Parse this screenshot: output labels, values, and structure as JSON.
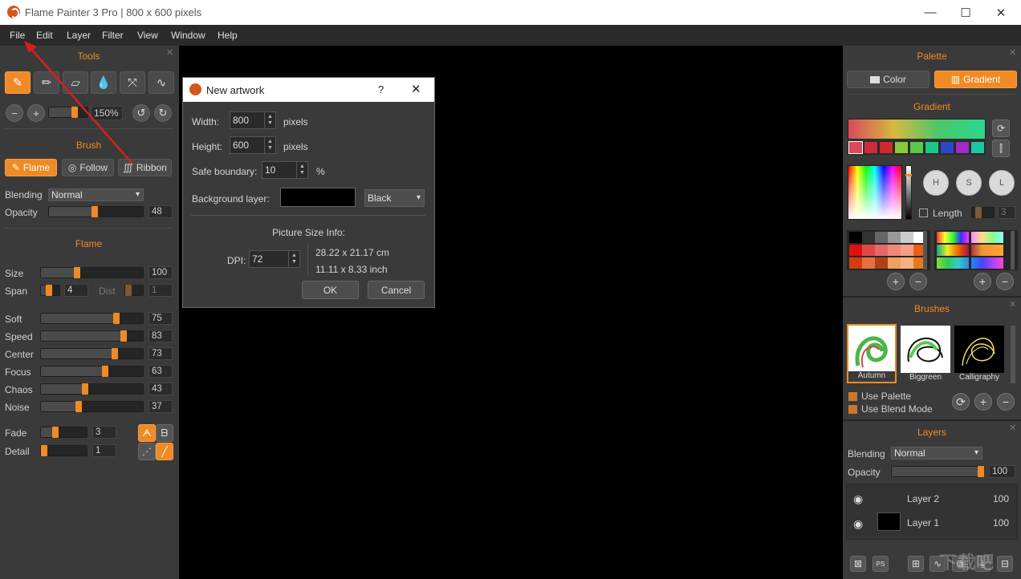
{
  "window": {
    "title": "Flame Painter 3 Pro | 800 x 600 pixels"
  },
  "menu": [
    "File",
    "Edit",
    "Layer",
    "Filter",
    "View",
    "Window",
    "Help"
  ],
  "tools": {
    "title": "Tools",
    "zoom": "150%",
    "brush_title": "Brush",
    "brush_buttons": [
      "Flame",
      "Follow",
      "Ribbon"
    ],
    "blending_label": "Blending",
    "blending_value": "Normal",
    "opacity_label": "Opacity",
    "opacity_value": "48",
    "flame_title": "Flame",
    "params": [
      {
        "label": "Size",
        "value": "100",
        "level": 0.35
      },
      {
        "label": "Soft",
        "value": "75",
        "level": 0.75
      },
      {
        "label": "Speed",
        "value": "83",
        "level": 0.83
      },
      {
        "label": "Center",
        "value": "73",
        "level": 0.73
      },
      {
        "label": "Focus",
        "value": "63",
        "level": 0.63
      },
      {
        "label": "Chaos",
        "value": "43",
        "level": 0.43
      },
      {
        "label": "Noise",
        "value": "37",
        "level": 0.37
      }
    ],
    "span_label": "Span",
    "span_value": "4",
    "dist_label": "Dist",
    "dist_value": "1",
    "fade_label": "Fade",
    "fade_value": "3",
    "detail_label": "Detail",
    "detail_value": "1"
  },
  "dialog": {
    "title": "New artwork",
    "help": "?",
    "width_label": "Width:",
    "width_value": "800",
    "width_unit": "pixels",
    "height_label": "Height:",
    "height_value": "600",
    "height_unit": "pixels",
    "safe_label": "Safe boundary:",
    "safe_value": "10",
    "safe_unit": "%",
    "bg_label": "Background layer:",
    "bg_color": "#000000",
    "bg_value": "Black",
    "info_title": "Picture Size Info:",
    "dpi_label": "DPI:",
    "dpi_value": "72",
    "size_cm": "28.22 x 21.17 cm",
    "size_inch": "11.11 x 8.33 inch",
    "ok": "OK",
    "cancel": "Cancel"
  },
  "palette": {
    "title": "Palette",
    "tab_color": "Color",
    "tab_gradient": "Gradient",
    "gradient_title": "Gradient",
    "hsl": [
      "H",
      "S",
      "L"
    ],
    "length_label": "Length",
    "length_value": "3"
  },
  "brushes": {
    "title": "Brushes",
    "items": [
      "Autumn",
      "Biggreen",
      "Calligraphy"
    ],
    "use_palette": "Use Palette",
    "use_blend": "Use Blend Mode"
  },
  "layers": {
    "title": "Layers",
    "blending_label": "Blending",
    "blending_value": "Normal",
    "opacity_label": "Opacity",
    "opacity_value": "100",
    "opacity_level": 1.0,
    "items": [
      {
        "name": "Layer 2",
        "opacity": "100"
      },
      {
        "name": "Layer 1",
        "opacity": "100"
      }
    ]
  },
  "colors": {
    "accent": "#f08a24",
    "panel": "#3a3a3a",
    "canvas": "#000000"
  }
}
